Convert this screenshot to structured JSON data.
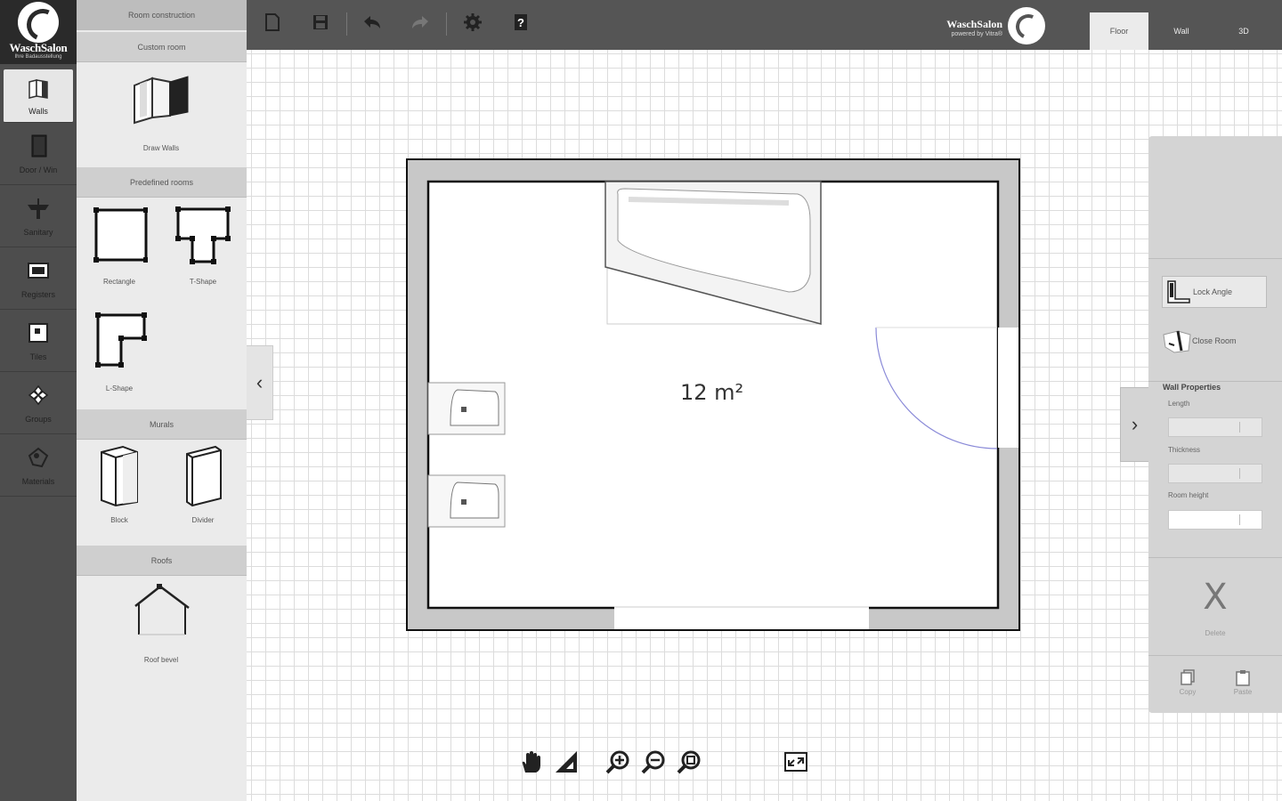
{
  "app": {
    "brand": "WaschSalon",
    "brand_sub": "Ihre Badausstellung",
    "brand_right": "WaschSalon",
    "brand_right_sub": "powered by Vitra®"
  },
  "leftnav": {
    "items": [
      {
        "label": "Walls",
        "icon": "walls-icon"
      },
      {
        "label": "Door / Win",
        "icon": "door-icon"
      },
      {
        "label": "Sanitary",
        "icon": "sink-icon"
      },
      {
        "label": "Registers",
        "icon": "register-icon"
      },
      {
        "label": "Tiles",
        "icon": "tiles-icon"
      },
      {
        "label": "Groups",
        "icon": "groups-icon"
      },
      {
        "label": "Materials",
        "icon": "materials-icon"
      }
    ]
  },
  "panel": {
    "title": "Room construction",
    "sections": {
      "custom": "Custom room",
      "predefined": "Predefined rooms",
      "murals": "Murals",
      "roofs": "Roofs"
    },
    "tools": {
      "draw_walls": "Draw Walls",
      "rectangle": "Rectangle",
      "t_shape": "T-Shape",
      "l_shape": "L-Shape",
      "block": "Block",
      "divider": "Divider",
      "roof_bevel": "Roof bevel"
    }
  },
  "toolbar": {
    "tabs": [
      "Floor",
      "Wall",
      "3D"
    ],
    "active_tab": "Floor"
  },
  "canvas": {
    "area": "12 m²"
  },
  "rpanel": {
    "lock_angle": "Lock Angle",
    "close_room": "Close Room",
    "wall_properties": "Wall Properties",
    "length_label": "Length",
    "thickness_label": "Thickness",
    "room_height_label": "Room height",
    "delete_symbol": "X",
    "delete_label": "Delete",
    "copy_label": "Copy",
    "paste_label": "Paste"
  }
}
